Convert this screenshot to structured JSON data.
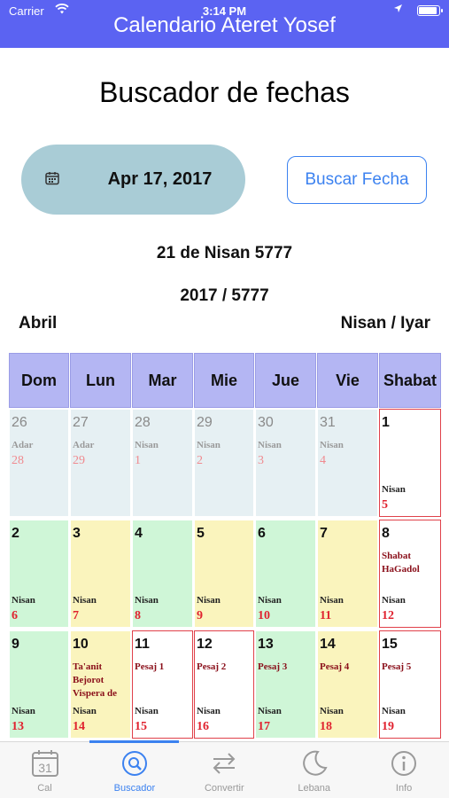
{
  "status": {
    "carrier": "Carrier",
    "time": "3:14 PM"
  },
  "app_title": "Calendario Ateret Yosef",
  "page_title": "Buscador de fechas",
  "date_picker": {
    "value": "Apr 17, 2017"
  },
  "search_button": "Buscar Fecha",
  "hebrew_date": "21 de Nisan 5777",
  "year_line": "2017 / 5777",
  "month_gregorian": "Abril",
  "month_hebrew": "Nisan / Iyar",
  "weekdays": [
    "Dom",
    "Lun",
    "Mar",
    "Mie",
    "Jue",
    "Vie",
    "Shabat"
  ],
  "colors": {
    "accent": "#5b63f2",
    "link": "#3c82f0",
    "header": "#b4b6f3",
    "hebrew_day": "#e0222f"
  },
  "weeks": [
    [
      {
        "day": "26",
        "month": "Adar",
        "heb": "28",
        "type": "blue",
        "dim": true,
        "event": ""
      },
      {
        "day": "27",
        "month": "Adar",
        "heb": "29",
        "type": "blue",
        "dim": true,
        "event": ""
      },
      {
        "day": "28",
        "month": "Nisan",
        "heb": "1",
        "type": "blue",
        "dim": true,
        "event": ""
      },
      {
        "day": "29",
        "month": "Nisan",
        "heb": "2",
        "type": "blue",
        "dim": true,
        "event": ""
      },
      {
        "day": "30",
        "month": "Nisan",
        "heb": "3",
        "type": "blue",
        "dim": true,
        "event": ""
      },
      {
        "day": "31",
        "month": "Nisan",
        "heb": "4",
        "type": "blue",
        "dim": true,
        "event": ""
      },
      {
        "day": "1",
        "month": "Nisan",
        "heb": "5",
        "type": "red",
        "dim": false,
        "event": ""
      }
    ],
    [
      {
        "day": "2",
        "month": "Nisan",
        "heb": "6",
        "type": "green",
        "dim": false,
        "event": ""
      },
      {
        "day": "3",
        "month": "Nisan",
        "heb": "7",
        "type": "yellow",
        "dim": false,
        "event": ""
      },
      {
        "day": "4",
        "month": "Nisan",
        "heb": "8",
        "type": "green",
        "dim": false,
        "event": ""
      },
      {
        "day": "5",
        "month": "Nisan",
        "heb": "9",
        "type": "yellow",
        "dim": false,
        "event": ""
      },
      {
        "day": "6",
        "month": "Nisan",
        "heb": "10",
        "type": "green",
        "dim": false,
        "event": ""
      },
      {
        "day": "7",
        "month": "Nisan",
        "heb": "11",
        "type": "yellow",
        "dim": false,
        "event": ""
      },
      {
        "day": "8",
        "month": "Nisan",
        "heb": "12",
        "type": "red",
        "dim": false,
        "event": "Shabat HaGadol"
      }
    ],
    [
      {
        "day": "9",
        "month": "Nisan",
        "heb": "13",
        "type": "green",
        "dim": false,
        "event": ""
      },
      {
        "day": "10",
        "month": "Nisan",
        "heb": "14",
        "type": "yellow",
        "dim": false,
        "event": "Ta'anit Bejorot Vispera de"
      },
      {
        "day": "11",
        "month": "Nisan",
        "heb": "15",
        "type": "red",
        "dim": false,
        "event": "Pesaj 1"
      },
      {
        "day": "12",
        "month": "Nisan",
        "heb": "16",
        "type": "red",
        "dim": false,
        "event": "Pesaj 2"
      },
      {
        "day": "13",
        "month": "Nisan",
        "heb": "17",
        "type": "green",
        "dim": false,
        "event": "Pesaj 3"
      },
      {
        "day": "14",
        "month": "Nisan",
        "heb": "18",
        "type": "yellow",
        "dim": false,
        "event": "Pesaj 4"
      },
      {
        "day": "15",
        "month": "Nisan",
        "heb": "19",
        "type": "red",
        "dim": false,
        "event": "Pesaj 5"
      }
    ]
  ],
  "tabs": [
    {
      "label": "Cal",
      "icon": "calendar-icon",
      "active": false
    },
    {
      "label": "Buscador",
      "icon": "search-icon",
      "active": true
    },
    {
      "label": "Convertir",
      "icon": "convert-icon",
      "active": false
    },
    {
      "label": "Lebana",
      "icon": "moon-icon",
      "active": false
    },
    {
      "label": "Info",
      "icon": "info-icon",
      "active": false
    }
  ]
}
